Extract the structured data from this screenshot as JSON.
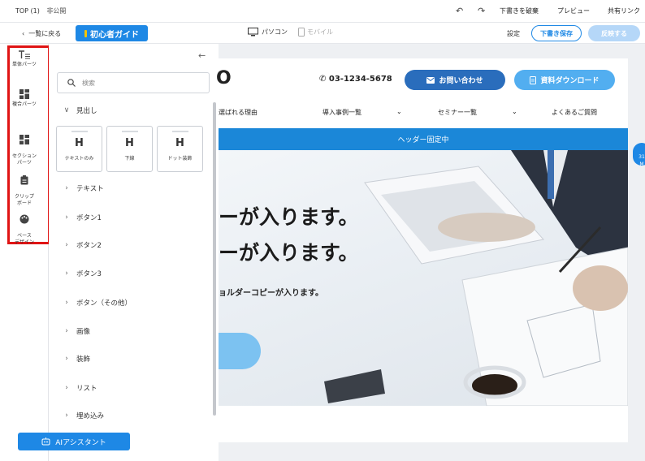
{
  "topbar": {
    "page_name": "TOP (1)",
    "visibility": "非公開",
    "undo_icon": "undo-icon",
    "redo_icon": "redo-icon",
    "discard_draft": "下書きを破棄",
    "preview": "プレビュー",
    "share_link": "共有リンク"
  },
  "toolbar": {
    "back": "一覧に戻る",
    "beginner_guide": "初心者ガイド",
    "device_pc": "パソコン",
    "device_mobile": "モバイル",
    "settings": "設定",
    "save_draft": "下書き保存",
    "reflect": "反映する"
  },
  "rail": {
    "items": [
      {
        "label": "単体パーツ",
        "icon": "text-parts-icon"
      },
      {
        "label": "複合パーツ",
        "icon": "grid-parts-icon"
      },
      {
        "label": "セクション\nパーツ",
        "icon": "section-icon"
      },
      {
        "label": "クリップ\nボード",
        "icon": "clipboard-icon"
      },
      {
        "label": "ベース\nデザイン",
        "icon": "palette-icon"
      }
    ],
    "highlight_color": "#e01414"
  },
  "panel": {
    "search_placeholder": "検索",
    "heading_category": "見出し",
    "heading_cards": [
      "テキストのみ",
      "下線",
      "ドット装飾"
    ],
    "heading_glyph": "H",
    "categories": [
      "テキスト",
      "ボタン1",
      "ボタン2",
      "ボタン3",
      "ボタン（その他）",
      "画像",
      "装飾",
      "リスト",
      "埋め込み"
    ],
    "ai_assistant": "AIアシスタント"
  },
  "canvas": {
    "logo_fragment": "O",
    "phone": "03-1234-5678",
    "contact_button": "お問い合わせ",
    "download_button": "資料ダウンロード",
    "nav": [
      "選ばれる理由",
      "導入事例一覧",
      "セミナー一覧",
      "よくあるご質問"
    ],
    "fixed_header": "ヘッダー固定中",
    "hero_copy_1": "ーが入ります。",
    "hero_copy_2": "ーが入ります。",
    "hero_sub": "ョルダーコピーが入ります。",
    "edge_badge": "31\nM"
  },
  "colors": {
    "primary": "#1e88e5",
    "dark_blue": "#2a6dbc",
    "light_blue": "#52aef0",
    "fixed_bar": "#1b87d8"
  }
}
